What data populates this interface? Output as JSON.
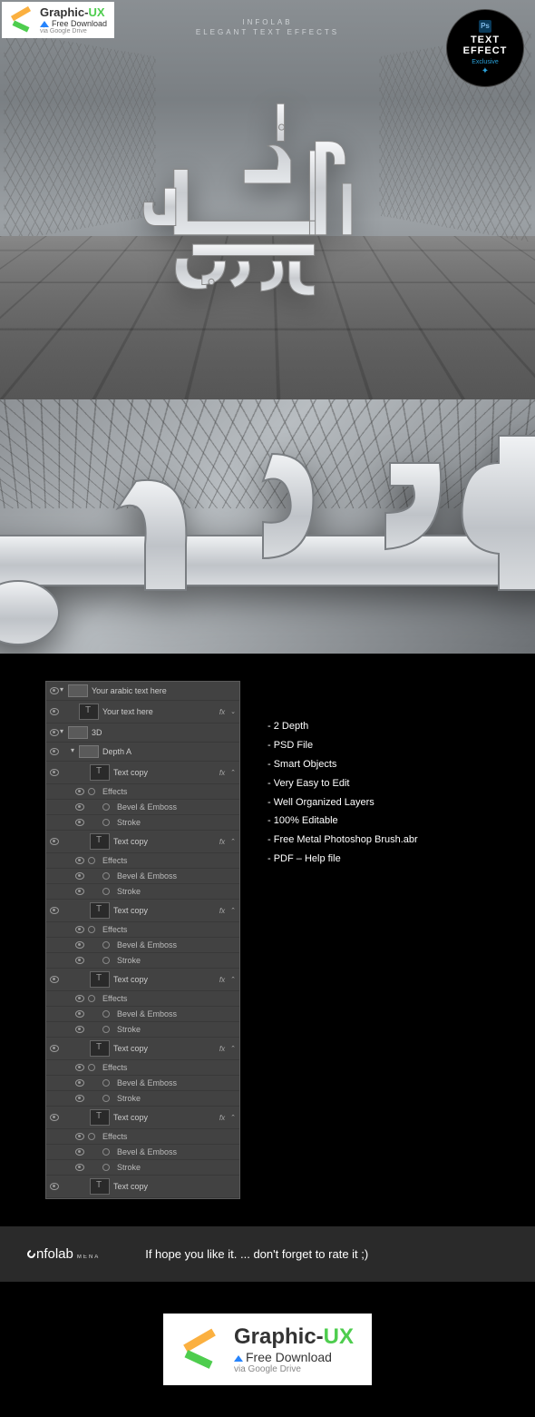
{
  "watermark": {
    "brand1": "Graphic-",
    "brand2": "UX",
    "line2": "Free Download",
    "line3": "via Google Drive"
  },
  "hero": {
    "top1": "INFOLAB",
    "top2": "ELEGANT TEXT EFFECTS"
  },
  "badge": {
    "ps": "Ps",
    "line1": "TEXT",
    "line2": "EFFECT",
    "exclusive": "Exclusive"
  },
  "layers": {
    "group_main": "Your arabic text here",
    "your_text": "Your text here",
    "group_3d": "3D",
    "group_depth": "Depth A",
    "text_copy": "Text copy",
    "effects": "Effects",
    "bevel": "Bevel & Emboss",
    "stroke": "Stroke",
    "fx": "fx"
  },
  "features": [
    "- 2 Depth",
    "- PSD File",
    "- Smart Objects",
    "- Very Easy to Edit",
    "- Well Organized Layers",
    "- 100% Editable",
    "- Free Metal Photoshop Brush.abr",
    "- PDF – Help file"
  ],
  "footer": {
    "logo1": "nfolab",
    "logo2": "MENA",
    "tagline": "If hope you like it. ... don't forget to rate it ;)"
  }
}
